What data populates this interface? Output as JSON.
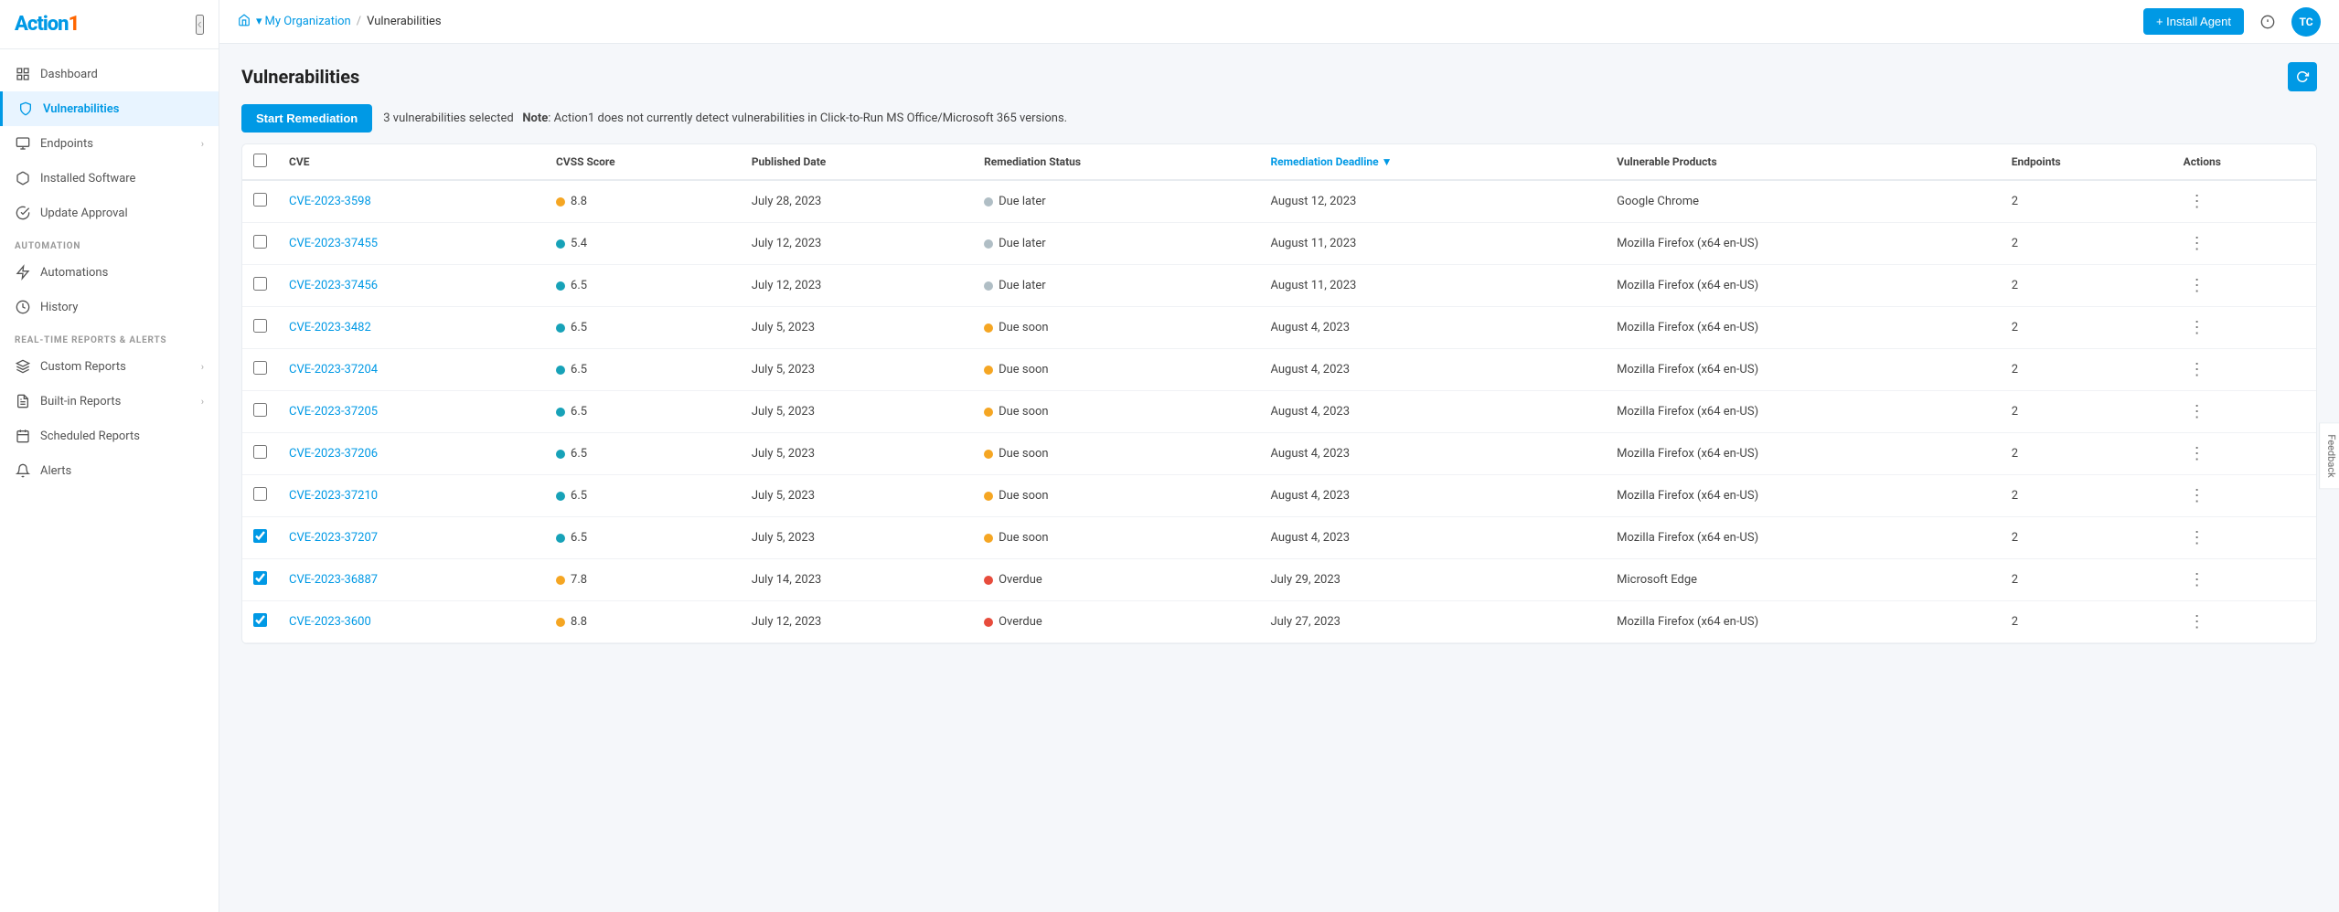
{
  "app": {
    "logo": "Action1",
    "logo_accent": "1"
  },
  "header": {
    "breadcrumb_home": "🏠",
    "breadcrumb_org": "My Organization",
    "breadcrumb_sep": "/",
    "breadcrumb_current": "Vulnerabilities",
    "install_agent_label": "+ Install Agent",
    "user_initials": "TC"
  },
  "sidebar": {
    "collapse_icon": "‹",
    "items": [
      {
        "id": "dashboard",
        "label": "Dashboard",
        "icon": "grid",
        "active": false
      },
      {
        "id": "vulnerabilities",
        "label": "Vulnerabilities",
        "icon": "shield",
        "active": true
      },
      {
        "id": "endpoints",
        "label": "Endpoints",
        "icon": "monitor",
        "active": false,
        "has_chevron": true
      },
      {
        "id": "installed-software",
        "label": "Installed Software",
        "icon": "package",
        "active": false
      },
      {
        "id": "update-approval",
        "label": "Update Approval",
        "icon": "check-circle",
        "active": false
      }
    ],
    "automation_label": "AUTOMATION",
    "automation_items": [
      {
        "id": "automations",
        "label": "Automations",
        "icon": "zap",
        "active": false
      },
      {
        "id": "history",
        "label": "History",
        "icon": "clock",
        "active": false
      }
    ],
    "reports_label": "REAL-TIME REPORTS & ALERTS",
    "reports_items": [
      {
        "id": "custom-reports",
        "label": "Custom Reports",
        "icon": "layers",
        "active": false,
        "has_chevron": true
      },
      {
        "id": "builtin-reports",
        "label": "Built-in Reports",
        "icon": "file-text",
        "active": false,
        "has_chevron": true
      },
      {
        "id": "scheduled-reports",
        "label": "Scheduled Reports",
        "icon": "calendar",
        "active": false
      },
      {
        "id": "alerts",
        "label": "Alerts",
        "icon": "bell",
        "active": false
      }
    ]
  },
  "page": {
    "title": "Vulnerabilities",
    "toolbar": {
      "remediate_label": "Start Remediation",
      "selection_text": "3 vulnerabilities selected",
      "note_prefix": "Note",
      "note_body": ": Action1 does not currently detect vulnerabilities in Click-to-Run MS Office/Microsoft 365 versions."
    },
    "table": {
      "columns": [
        {
          "id": "cve",
          "label": "CVE"
        },
        {
          "id": "cvss",
          "label": "CVSS Score"
        },
        {
          "id": "published",
          "label": "Published Date"
        },
        {
          "id": "status",
          "label": "Remediation Status"
        },
        {
          "id": "deadline",
          "label": "Remediation Deadline",
          "sorted": true
        },
        {
          "id": "products",
          "label": "Vulnerable Products"
        },
        {
          "id": "endpoints",
          "label": "Endpoints"
        },
        {
          "id": "actions",
          "label": "Actions"
        }
      ],
      "rows": [
        {
          "cve": "CVE-2023-3598",
          "cvss": "8.8",
          "cvss_color": "orange",
          "published": "July 28, 2023",
          "status": "Due later",
          "status_type": "due-later",
          "deadline": "August 12, 2023",
          "product": "Google Chrome",
          "endpoints": "2",
          "checked": false
        },
        {
          "cve": "CVE-2023-37455",
          "cvss": "5.4",
          "cvss_color": "teal",
          "published": "July 12, 2023",
          "status": "Due later",
          "status_type": "due-later",
          "deadline": "August 11, 2023",
          "product": "Mozilla Firefox (x64 en-US)",
          "endpoints": "2",
          "checked": false
        },
        {
          "cve": "CVE-2023-37456",
          "cvss": "6.5",
          "cvss_color": "teal",
          "published": "July 12, 2023",
          "status": "Due later",
          "status_type": "due-later",
          "deadline": "August 11, 2023",
          "product": "Mozilla Firefox (x64 en-US)",
          "endpoints": "2",
          "checked": false
        },
        {
          "cve": "CVE-2023-3482",
          "cvss": "6.5",
          "cvss_color": "teal",
          "published": "July 5, 2023",
          "status": "Due soon",
          "status_type": "due-soon",
          "deadline": "August 4, 2023",
          "product": "Mozilla Firefox (x64 en-US)",
          "endpoints": "2",
          "checked": false
        },
        {
          "cve": "CVE-2023-37204",
          "cvss": "6.5",
          "cvss_color": "teal",
          "published": "July 5, 2023",
          "status": "Due soon",
          "status_type": "due-soon",
          "deadline": "August 4, 2023",
          "product": "Mozilla Firefox (x64 en-US)",
          "endpoints": "2",
          "checked": false
        },
        {
          "cve": "CVE-2023-37205",
          "cvss": "6.5",
          "cvss_color": "teal",
          "published": "July 5, 2023",
          "status": "Due soon",
          "status_type": "due-soon",
          "deadline": "August 4, 2023",
          "product": "Mozilla Firefox (x64 en-US)",
          "endpoints": "2",
          "checked": false
        },
        {
          "cve": "CVE-2023-37206",
          "cvss": "6.5",
          "cvss_color": "teal",
          "published": "July 5, 2023",
          "status": "Due soon",
          "status_type": "due-soon",
          "deadline": "August 4, 2023",
          "product": "Mozilla Firefox (x64 en-US)",
          "endpoints": "2",
          "checked": false
        },
        {
          "cve": "CVE-2023-37210",
          "cvss": "6.5",
          "cvss_color": "teal",
          "published": "July 5, 2023",
          "status": "Due soon",
          "status_type": "due-soon",
          "deadline": "August 4, 2023",
          "product": "Mozilla Firefox (x64 en-US)",
          "endpoints": "2",
          "checked": false
        },
        {
          "cve": "CVE-2023-37207",
          "cvss": "6.5",
          "cvss_color": "teal",
          "published": "July 5, 2023",
          "status": "Due soon",
          "status_type": "due-soon",
          "deadline": "August 4, 2023",
          "product": "Mozilla Firefox (x64 en-US)",
          "endpoints": "2",
          "checked": true
        },
        {
          "cve": "CVE-2023-36887",
          "cvss": "7.8",
          "cvss_color": "orange",
          "published": "July 14, 2023",
          "status": "Overdue",
          "status_type": "overdue",
          "deadline": "July 29, 2023",
          "product": "Microsoft Edge",
          "endpoints": "2",
          "checked": true
        },
        {
          "cve": "CVE-2023-3600",
          "cvss": "8.8",
          "cvss_color": "orange",
          "published": "July 12, 2023",
          "status": "Overdue",
          "status_type": "overdue",
          "deadline": "July 27, 2023",
          "product": "Mozilla Firefox (x64 en-US)",
          "endpoints": "2",
          "checked": true
        }
      ]
    }
  },
  "feedback": "Feedback"
}
